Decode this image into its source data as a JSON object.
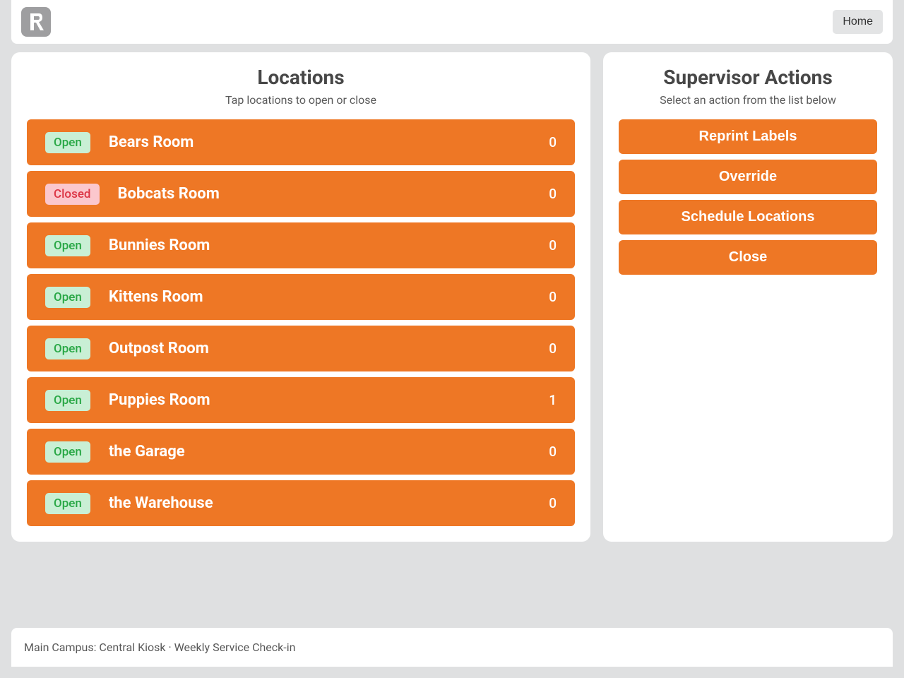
{
  "navbar": {
    "home_label": "Home"
  },
  "locations_panel": {
    "title": "Locations",
    "subtitle": "Tap locations to open or close",
    "status_labels": {
      "open": "Open",
      "closed": "Closed"
    },
    "items": [
      {
        "name": "Bears Room",
        "status": "open",
        "count": "0"
      },
      {
        "name": "Bobcats Room",
        "status": "closed",
        "count": "0"
      },
      {
        "name": "Bunnies Room",
        "status": "open",
        "count": "0"
      },
      {
        "name": "Kittens Room",
        "status": "open",
        "count": "0"
      },
      {
        "name": "Outpost Room",
        "status": "open",
        "count": "0"
      },
      {
        "name": "Puppies Room",
        "status": "open",
        "count": "1"
      },
      {
        "name": "the Garage",
        "status": "open",
        "count": "0"
      },
      {
        "name": "the Warehouse",
        "status": "open",
        "count": "0"
      }
    ]
  },
  "actions_panel": {
    "title": "Supervisor Actions",
    "subtitle": "Select an action from the list below",
    "items": [
      {
        "label": "Reprint Labels"
      },
      {
        "label": "Override"
      },
      {
        "label": "Schedule Locations"
      },
      {
        "label": "Close"
      }
    ]
  },
  "footer": {
    "text": "Main Campus: Central Kiosk · Weekly Service Check-in"
  }
}
